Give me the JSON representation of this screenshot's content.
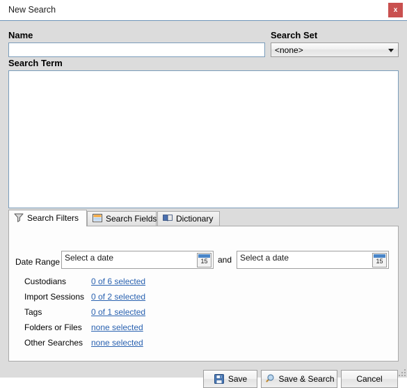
{
  "window": {
    "title": "New Search",
    "close_label": "x"
  },
  "form": {
    "name_label": "Name",
    "name_value": "",
    "name_placeholder": "",
    "search_set_label": "Search Set",
    "search_set_value": "<none>",
    "search_set_options": [
      "<none>"
    ],
    "search_term_label": "Search Term",
    "search_term_value": "",
    "search_term_placeholder": ""
  },
  "tabs": [
    {
      "label": "Search Filters",
      "icon": "funnel-icon",
      "active": true
    },
    {
      "label": "Search Fields",
      "icon": "table-icon",
      "active": false
    },
    {
      "label": "Dictionary",
      "icon": "book-icon",
      "active": false
    }
  ],
  "filters": {
    "date_range_label": "Date Range",
    "date_from_value": "Select a date",
    "date_to_value": "Select a date",
    "and_label": "and",
    "calendar_day": "15",
    "rows": [
      {
        "name": "Custodians",
        "link": "0 of 6 selected"
      },
      {
        "name": "Import Sessions",
        "link": "0 of 2 selected"
      },
      {
        "name": "Tags",
        "link": "0 of 1 selected"
      },
      {
        "name": "Folders or Files",
        "link": "none selected"
      },
      {
        "name": "Other Searches",
        "link": "none selected"
      }
    ]
  },
  "buttons": {
    "save_label": "Save",
    "save_icon": "floppy-disk-icon",
    "save_search_label": "Save & Search",
    "save_search_icon": "magnifier-icon",
    "cancel_label": "Cancel"
  },
  "colors": {
    "accent_blue": "#2a62b0",
    "close_red": "#c9504f",
    "body_gray": "#dcdcdc",
    "input_border": "#7a9cba",
    "calendar_blue": "#4a86c8"
  }
}
